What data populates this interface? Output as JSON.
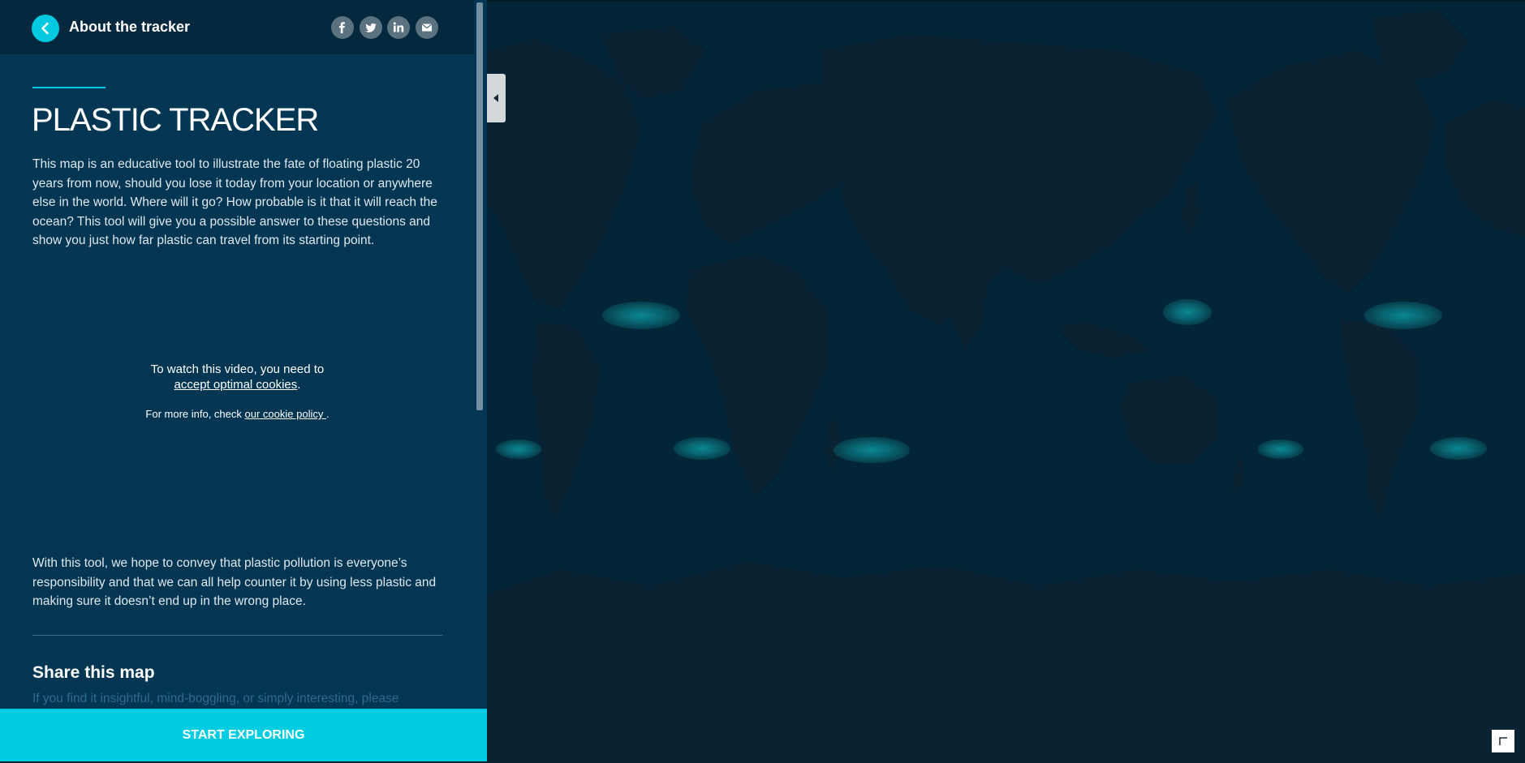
{
  "header": {
    "title": "About the tracker",
    "back_icon": "chevron-left-icon",
    "share_icons": [
      "facebook-icon",
      "twitter-icon",
      "linkedin-icon",
      "email-icon"
    ]
  },
  "content": {
    "title": "PLASTIC TRACKER",
    "intro": "This map is an educative tool to illustrate the fate of floating plastic 20 years from now, should you lose it today from your location or anywhere else in the world. Where will it go? How probable is it that it will reach the ocean? This tool will give you a possible answer to these questions and show you just how far plastic can travel from its starting point.",
    "video": {
      "message": "To watch this video, you need to",
      "cookie_link": "accept optimal cookies",
      "period": ".",
      "info_prefix": "For more info, check ",
      "policy_link": "our cookie policy ",
      "info_suffix": "."
    },
    "outro": "With this tool, we hope to convey that plastic pollution is everyone’s responsibility and that we can all help counter it by using less plastic and making sure it doesn’t end up in the wrong place.",
    "share_heading": "Share this map",
    "share_text": "If you find it insightful, mind-boggling, or simply interesting, please"
  },
  "cta": {
    "label": "START EXPLORING"
  },
  "colors": {
    "accent": "#00c9e0",
    "sidebar_bg": "#023652",
    "ocean": "#022538",
    "land": "#0a2333",
    "garbage_patch": "#0b8d97"
  },
  "map": {
    "collapse_icon": "caret-left-icon",
    "corner_icon": "fullscreen-icon"
  }
}
